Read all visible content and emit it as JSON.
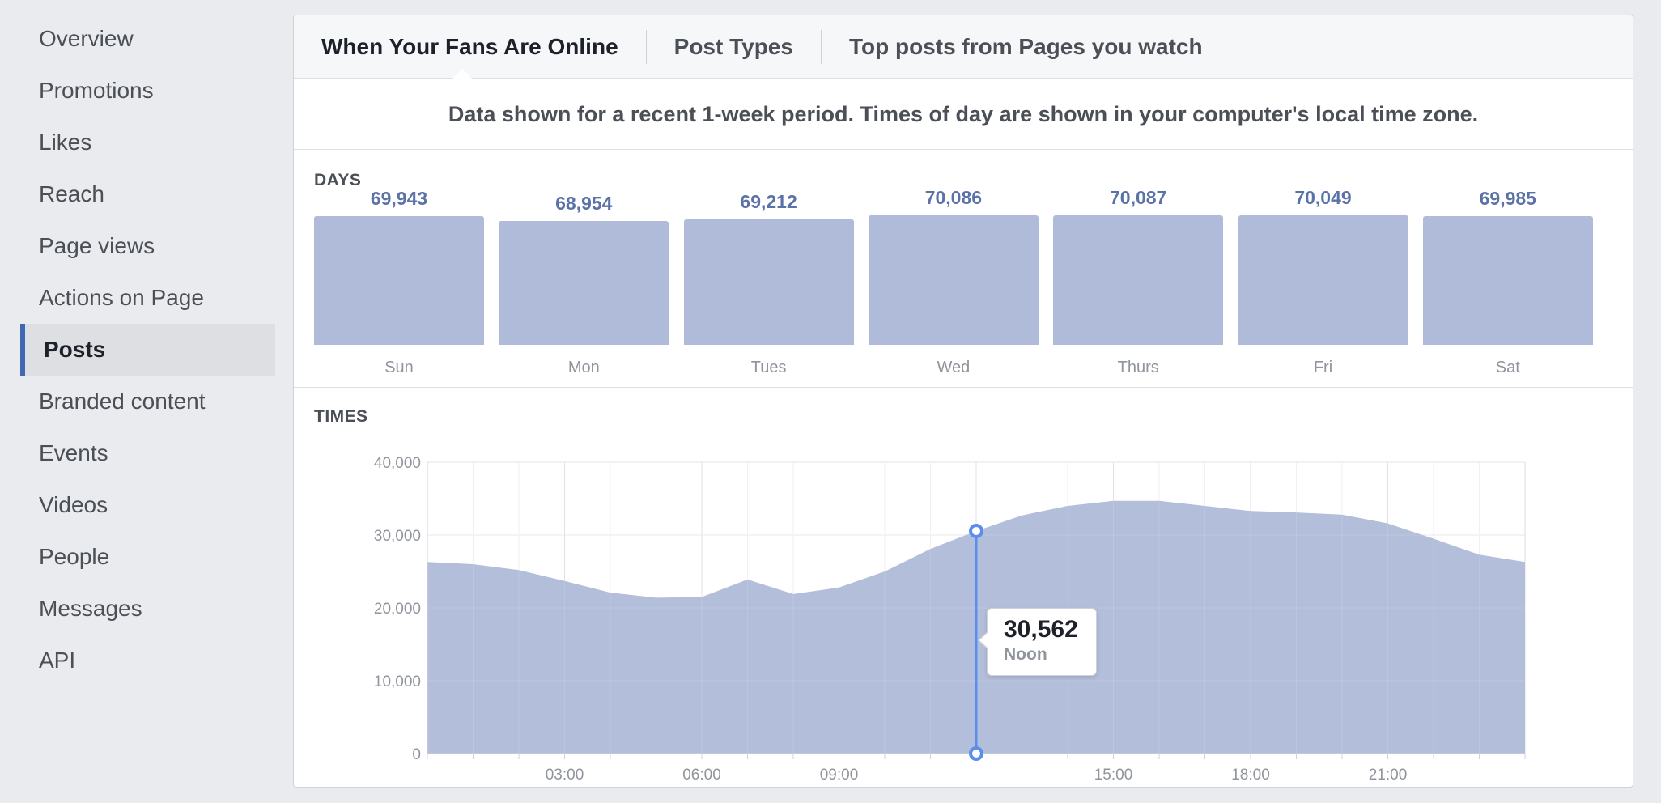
{
  "sidebar": {
    "items": [
      {
        "label": "Overview"
      },
      {
        "label": "Promotions"
      },
      {
        "label": "Likes"
      },
      {
        "label": "Reach"
      },
      {
        "label": "Page views"
      },
      {
        "label": "Actions on Page"
      },
      {
        "label": "Posts",
        "active": true
      },
      {
        "label": "Branded content"
      },
      {
        "label": "Events"
      },
      {
        "label": "Videos"
      },
      {
        "label": "People"
      },
      {
        "label": "Messages"
      },
      {
        "label": "API"
      }
    ]
  },
  "tabs": [
    {
      "label": "When Your Fans Are Online",
      "active": true
    },
    {
      "label": "Post Types"
    },
    {
      "label": "Top posts from Pages you watch"
    }
  ],
  "notice": "Data shown for a recent 1-week period. Times of day are shown in your computer's local time zone.",
  "days": {
    "label": "DAYS"
  },
  "times": {
    "label": "TIMES",
    "tooltip": {
      "value": "30,562",
      "label": "Noon"
    }
  },
  "colors": {
    "bar": "#afbbd8",
    "area": "#afbbd8",
    "accent": "#4267b2",
    "marker": "#5b8def"
  },
  "chart_data": [
    {
      "type": "bar",
      "title": "DAYS",
      "categories": [
        "Sun",
        "Mon",
        "Tues",
        "Wed",
        "Thurs",
        "Fri",
        "Sat"
      ],
      "values": [
        69943,
        68954,
        69212,
        70086,
        70087,
        70049,
        69985
      ],
      "value_labels": [
        "69,943",
        "68,954",
        "69,212",
        "70,086",
        "70,087",
        "70,049",
        "69,985"
      ]
    },
    {
      "type": "area",
      "title": "TIMES",
      "x": [
        0,
        1,
        2,
        3,
        4,
        5,
        6,
        7,
        8,
        9,
        10,
        11,
        12,
        13,
        14,
        15,
        16,
        17,
        18,
        19,
        20,
        21,
        22,
        23,
        24
      ],
      "values": [
        26300,
        26000,
        25200,
        23700,
        22100,
        21400,
        21500,
        23900,
        21900,
        22800,
        25000,
        28100,
        30562,
        32700,
        34000,
        34700,
        34700,
        34000,
        33300,
        33100,
        32800,
        31600,
        29500,
        27300,
        26300
      ],
      "x_ticks": [
        3,
        6,
        9,
        15,
        18,
        21
      ],
      "x_tick_labels": [
        "03:00",
        "06:00",
        "09:00",
        "15:00",
        "18:00",
        "21:00"
      ],
      "y_ticks": [
        0,
        10000,
        20000,
        30000,
        40000
      ],
      "y_tick_labels": [
        "0",
        "10,000",
        "20,000",
        "30,000",
        "40,000"
      ],
      "ylim": [
        0,
        40000
      ],
      "xlim": [
        0,
        24
      ],
      "highlight_x": 12,
      "grid": true
    }
  ]
}
